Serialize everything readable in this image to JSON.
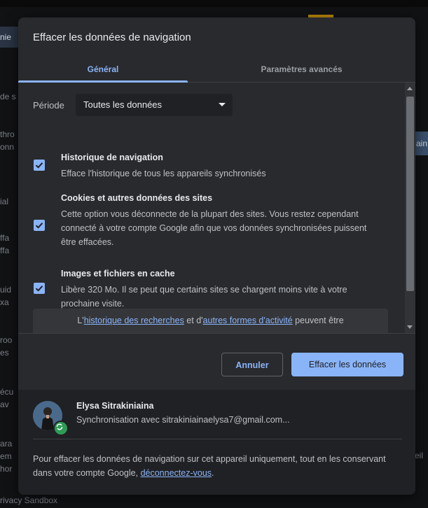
{
  "background": {
    "left_fragments": [
      "nie",
      "de s",
      "thro",
      "onn",
      "ial",
      "ffa",
      "ffa",
      "uid",
      "xa",
      "roo",
      "es",
      "écu",
      "av",
      "ara",
      "em",
      "hor"
    ],
    "right_button": "ain",
    "right_text": "eil",
    "bottom_text": "rivacy Sandbox"
  },
  "dialog": {
    "title": "Effacer les données de navigation",
    "tabs": [
      {
        "label": "Général",
        "active": true
      },
      {
        "label": "Paramètres avancés",
        "active": false
      }
    ],
    "period": {
      "label": "Période",
      "value": "Toutes les données"
    },
    "options": [
      {
        "title": "Historique de navigation",
        "description": "Efface l'historique de tous les appareils synchronisés",
        "checked": true
      },
      {
        "title": "Cookies et autres données des sites",
        "description": "Cette option vous déconnecte de la plupart des sites. Vous restez cependant connecté à votre compte Google afin que vos données synchronisées puissent être effacées.",
        "checked": true
      },
      {
        "title": "Images et fichiers en cache",
        "description": "Libère 320 Mo. Il se peut que certains sites se chargent moins vite à votre prochaine visite.",
        "checked": true
      }
    ],
    "notice": {
      "prefix": "L'",
      "link1": "historique des recherches",
      "middle": " et d'",
      "link2": "autres formes d'activité",
      "suffix": " peuvent être"
    },
    "buttons": {
      "cancel": "Annuler",
      "clear": "Effacer les données"
    },
    "account": {
      "name": "Elysa Sitrakiniaina",
      "sync": "Synchronisation avec sitrakiniainaelysa7@gmail.com..."
    },
    "footer_note": {
      "text": "Pour effacer les données de navigation sur cet appareil uniquement, tout en les conservant dans votre compte Google, ",
      "link": "déconnectez-vous",
      "end": "."
    }
  },
  "colors": {
    "accent": "#8ab4f8",
    "dialog_bg": "#292a2d",
    "sync_green": "#2e9c57"
  }
}
